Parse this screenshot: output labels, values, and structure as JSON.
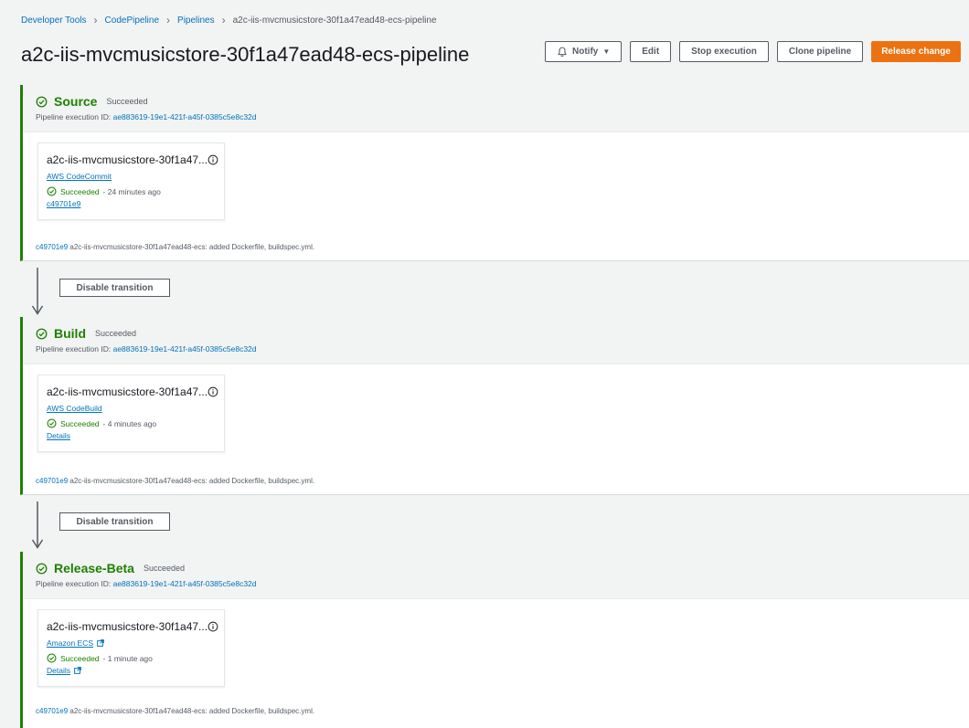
{
  "breadcrumb": {
    "items": [
      "Developer Tools",
      "CodePipeline",
      "Pipelines"
    ],
    "current": "a2c-iis-mvcmusicstore-30f1a47ead48-ecs-pipeline"
  },
  "page": {
    "title": "a2c-iis-mvcmusicstore-30f1a47ead48-ecs-pipeline"
  },
  "toolbar": {
    "notify_label": "Notify",
    "edit_label": "Edit",
    "stop_label": "Stop execution",
    "clone_label": "Clone pipeline",
    "release_label": "Release change"
  },
  "exec_label": "Pipeline execution ID:",
  "stages": [
    {
      "name": "Source",
      "status": "Succeeded",
      "execution_id": "ae883619-19e1-421f-a45f-0385c5e8c32d",
      "action": {
        "name": "a2c-iis-mvcmusicstore-30f1a47...",
        "provider": "AWS CodeCommit",
        "status": "Succeeded",
        "time": "- 24 minutes ago",
        "sub_link": "c49701e9"
      },
      "commit_id": "c49701e9",
      "commit_message": "a2c-iis-mvcmusicstore-30f1a47ead48-ecs: added Dockerfile, buildspec.yml."
    },
    {
      "name": "Build",
      "status": "Succeeded",
      "execution_id": "ae883619-19e1-421f-a45f-0385c5e8c32d",
      "action": {
        "name": "a2c-iis-mvcmusicstore-30f1a47...",
        "provider": "AWS CodeBuild",
        "status": "Succeeded",
        "time": "- 4 minutes ago",
        "sub_link": "Details"
      },
      "commit_id": "c49701e9",
      "commit_message": "a2c-iis-mvcmusicstore-30f1a47ead48-ecs: added Dockerfile, buildspec.yml."
    },
    {
      "name": "Release-Beta",
      "status": "Succeeded",
      "execution_id": "ae883619-19e1-421f-a45f-0385c5e8c32d",
      "action": {
        "name": "a2c-iis-mvcmusicstore-30f1a47...",
        "provider": "Amazon ECS",
        "status": "Succeeded",
        "time": "- 1 minute ago",
        "sub_link": "Details"
      },
      "commit_id": "c49701e9",
      "commit_message": "a2c-iis-mvcmusicstore-30f1a47ead48-ecs: added Dockerfile, buildspec.yml."
    }
  ],
  "transitions": [
    {
      "label": "Disable transition"
    },
    {
      "label": "Disable transition"
    }
  ],
  "colors": {
    "success": "#1d8102",
    "link": "#0073bb",
    "primary": "#ec7211",
    "background": "#f2f3f3"
  },
  "icons": {
    "stage_status": "check-circle-icon",
    "info": "info-icon",
    "external": "external-link-icon",
    "notify": "bell-icon",
    "transition": "arrow-down-icon"
  }
}
